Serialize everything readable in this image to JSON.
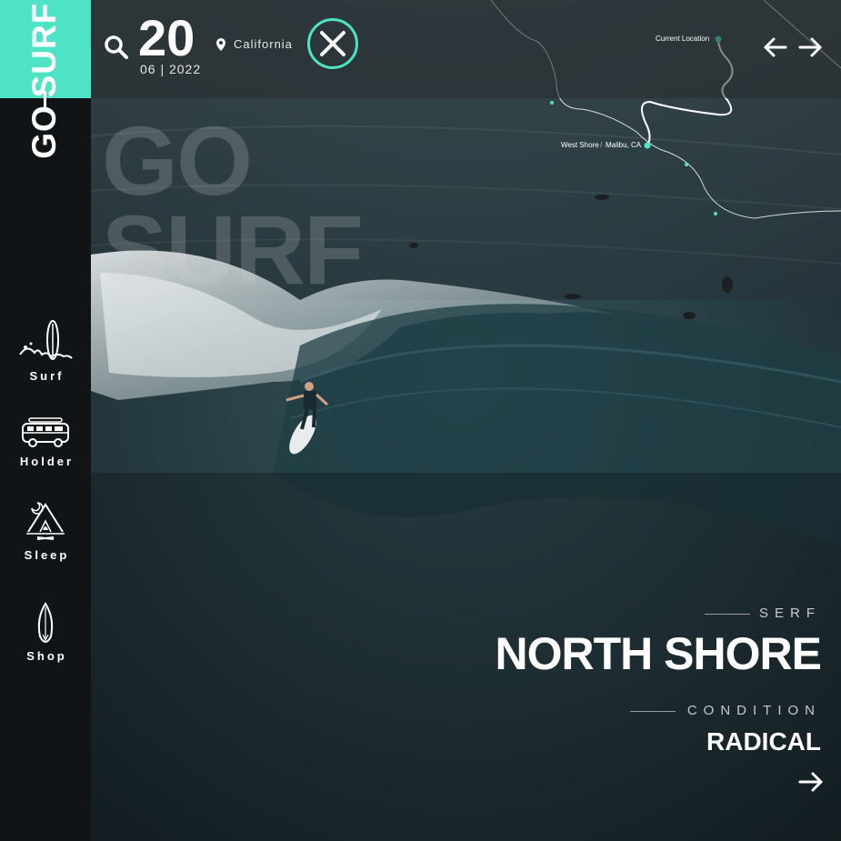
{
  "brand": {
    "word_top": "SURF",
    "word_bottom": "GO"
  },
  "sidebar": {
    "items": [
      {
        "label": "Surf",
        "icon": "surfboard-wave-icon"
      },
      {
        "label": "Holder",
        "icon": "van-icon"
      },
      {
        "label": "Sleep",
        "icon": "tent-icon"
      },
      {
        "label": "Shop",
        "icon": "surfboard-icon"
      }
    ]
  },
  "header": {
    "day": "20",
    "month_year": "06 | 2022",
    "location": "California"
  },
  "map": {
    "current_location_label": "Current Location",
    "west_shore_label": "West Shore",
    "malibu_label": "Malibu, CA"
  },
  "watermark": {
    "line1": "GO",
    "line2": "SURF"
  },
  "spot": {
    "kicker": "SERF",
    "name": "NORTH SHORE",
    "condition_kicker": "CONDITION",
    "condition_value": "RADICAL"
  },
  "colors": {
    "accent": "#4fe3c6",
    "sidebar": "#111416",
    "ocean": "#2c4a52"
  }
}
